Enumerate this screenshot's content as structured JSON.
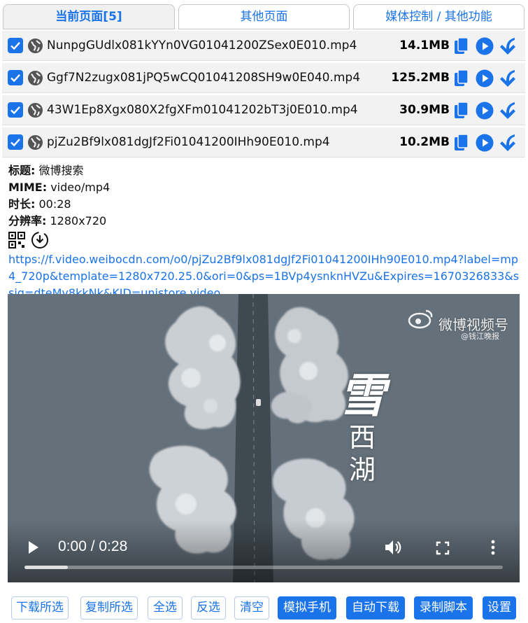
{
  "tabs": [
    {
      "label": "当前页面[5]"
    },
    {
      "label": "其他页面"
    },
    {
      "label": "媒体控制 / 其他功能"
    }
  ],
  "files": [
    {
      "name": "NunpgGUdlx081kYYn0VG01041200ZSex0E010.mp4",
      "size": "14.1MB",
      "checked": true
    },
    {
      "name": "Ggf7N2zugx081jPQ5wCQ01041208SH9w0E040.mp4",
      "size": "125.2MB",
      "checked": true
    },
    {
      "name": "43W1Ep8Xgx080X2fgXFm01041202bT3j0E010.mp4",
      "size": "30.9MB",
      "checked": true
    },
    {
      "name": "pjZu2Bf9lx081dgJf2Fi01041200IHh90E010.mp4",
      "size": "10.2MB",
      "checked": true
    }
  ],
  "detail": {
    "title_label": "标题:",
    "title_value": " 微博搜索",
    "mime_label": "MIME:",
    "mime_value": " video/mp4",
    "duration_label": "时长:",
    "duration_value": " 00:28",
    "resolution_label": "分辨率:",
    "resolution_value": " 1280x720",
    "url": "https://f.video.weibocdn.com/o0/pjZu2Bf9lx081dgJf2Fi01041200IHh90E010.mp4?label=mp4_720p&template=1280x720.25.0&ori=0&ps=1BVp4ysnknHVZu&Expires=1670326833&ssig=dteMy8kkNk&KID=unistore,video"
  },
  "video": {
    "watermark": "微博视频号",
    "watermark_sub": "@钱江晚报",
    "title_big": "雪",
    "title_small": "西湖",
    "time": "0:00 / 0:28",
    "progress": 0.09
  },
  "buttons": [
    {
      "label": "下载所选"
    },
    {
      "label": "复制所选"
    },
    {
      "label": "全选"
    },
    {
      "label": "反选"
    },
    {
      "label": "清空"
    },
    {
      "label": "模拟手机"
    },
    {
      "label": "自动下载"
    },
    {
      "label": "录制脚本"
    },
    {
      "label": "设置"
    }
  ],
  "colors": {
    "accent": "#1a73e8",
    "row_bg": "#f2f2f2"
  }
}
